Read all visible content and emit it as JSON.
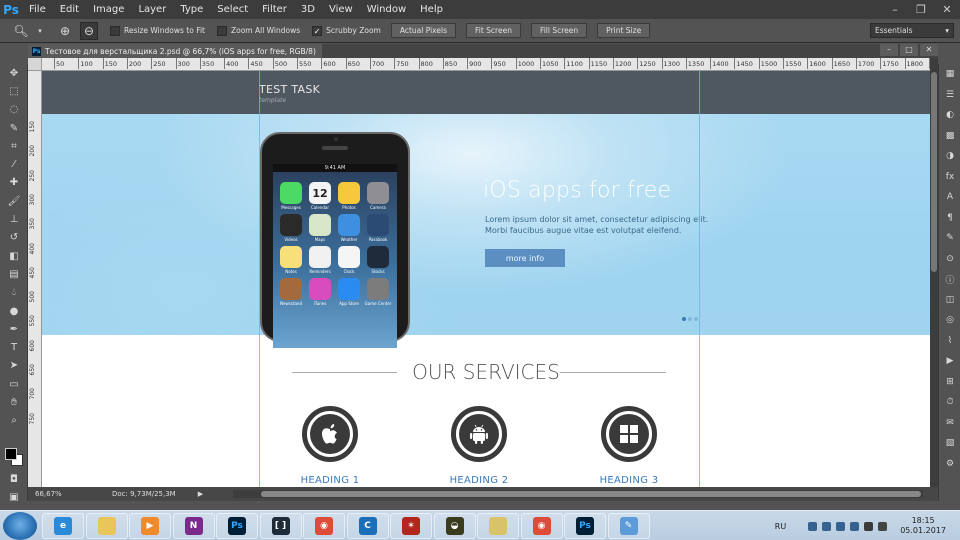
{
  "app": {
    "logo": "Ps",
    "menu": [
      "File",
      "Edit",
      "Image",
      "Layer",
      "Type",
      "Select",
      "Filter",
      "3D",
      "View",
      "Window",
      "Help"
    ]
  },
  "options": {
    "resize_windows": "Resize Windows to Fit",
    "zoom_all": "Zoom All Windows",
    "scrubby_zoom": "Scrubby Zoom",
    "buttons": [
      "Actual Pixels",
      "Fit Screen",
      "Fill Screen",
      "Print Size"
    ],
    "workspace": "Essentials"
  },
  "document": {
    "tab_title": "Тестовое для верстальщика 2.psd @ 66,7% (iOS apps for free, RGB/8)",
    "ruler_h": [
      "50",
      "100",
      "150",
      "200",
      "250",
      "300",
      "350",
      "400",
      "450",
      "500",
      "550",
      "600",
      "650",
      "700",
      "750",
      "800",
      "850",
      "900",
      "950",
      "1000",
      "1050",
      "1100",
      "1150",
      "1200",
      "1250",
      "1300",
      "1350",
      "1400",
      "1450",
      "1500",
      "1550",
      "1600",
      "1650",
      "1700",
      "1750",
      "1800",
      "1850"
    ],
    "ruler_v": [
      "150",
      "200",
      "250",
      "300",
      "350",
      "400",
      "450",
      "500",
      "550",
      "600",
      "650",
      "700",
      "750"
    ],
    "zoom": "66,67%",
    "doc_size": "Doc: 9,73M/25,3M"
  },
  "site": {
    "logo_title": "TEST TASK",
    "logo_sub": "template",
    "hero": {
      "title": "iOS apps for free",
      "text": "Lorem ipsum dolor sit amet, consectetur adipiscing elit. Morbi faucibus augue vitae est volutpat eleifend.",
      "button": "more info"
    },
    "phone": {
      "time": "9:41 AM",
      "calendar_day": "12",
      "apps": [
        "Messages",
        "Calendar",
        "Photos",
        "Camera",
        "Videos",
        "Maps",
        "Weather",
        "Passbook",
        "Notes",
        "Reminders",
        "Clock",
        "Stocks",
        "Newsstand",
        "iTunes",
        "App Store",
        "Game Center"
      ]
    },
    "services_title": "OUR SERVICES",
    "services": [
      "HEADING 1",
      "HEADING 2",
      "HEADING 3"
    ],
    "colors": {
      "header": "#4f5761",
      "accent": "#3b7ab7",
      "button": "#5b8fc2",
      "guide": "#35d0e6"
    }
  },
  "taskbar": {
    "apps": [
      "internet-explorer",
      "file-explorer",
      "media-player",
      "onenote",
      "photoshop",
      "bracket-app",
      "chrome",
      "ccleaner",
      "antivirus",
      "cup-app",
      "file-folder",
      "chrome",
      "photoshop",
      "paint"
    ],
    "lang": "RU",
    "time": "18:15",
    "date": "05.01.2017"
  }
}
